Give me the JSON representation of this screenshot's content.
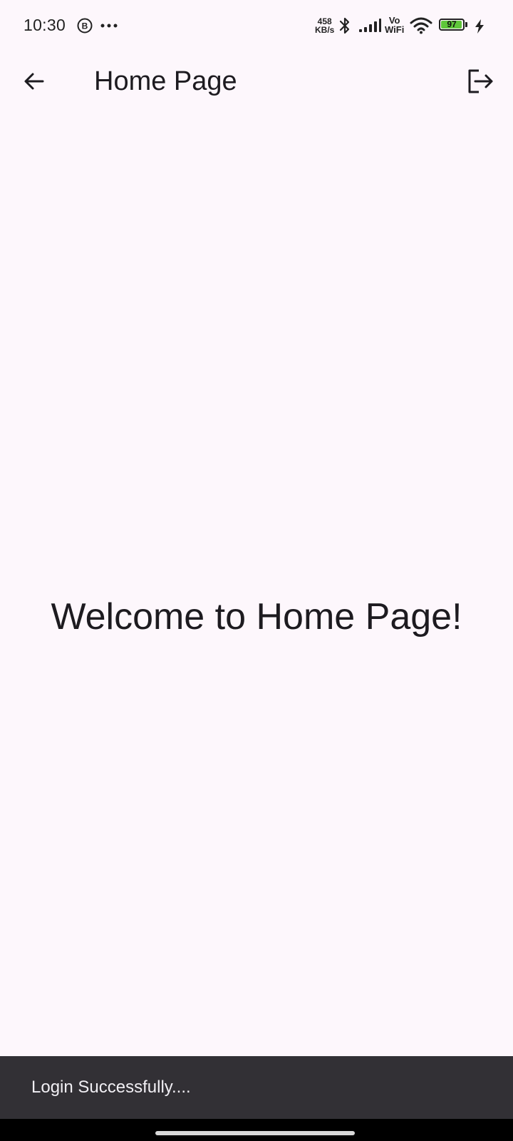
{
  "status_bar": {
    "time": "10:30",
    "speed_value": "458",
    "speed_unit": "KB/s",
    "vowifi_top": "Vo",
    "vowifi_bottom": "WiFi",
    "battery_level": "97",
    "icons": [
      "b-circle-icon",
      "more-dots-icon",
      "bluetooth-icon",
      "signal-icon",
      "wifi-icon",
      "battery-icon",
      "charging-bolt-icon"
    ]
  },
  "app_bar": {
    "title": "Home Page",
    "icons": [
      "back-arrow-icon",
      "logout-icon"
    ]
  },
  "main": {
    "welcome_text": "Welcome to Home Page!"
  },
  "snackbar": {
    "message": "Login Successfully...."
  },
  "colors": {
    "background": "#FDF7FC",
    "snackbar_bg": "#323035",
    "battery_fill": "#5fc63a",
    "text": "#1d1b20"
  }
}
